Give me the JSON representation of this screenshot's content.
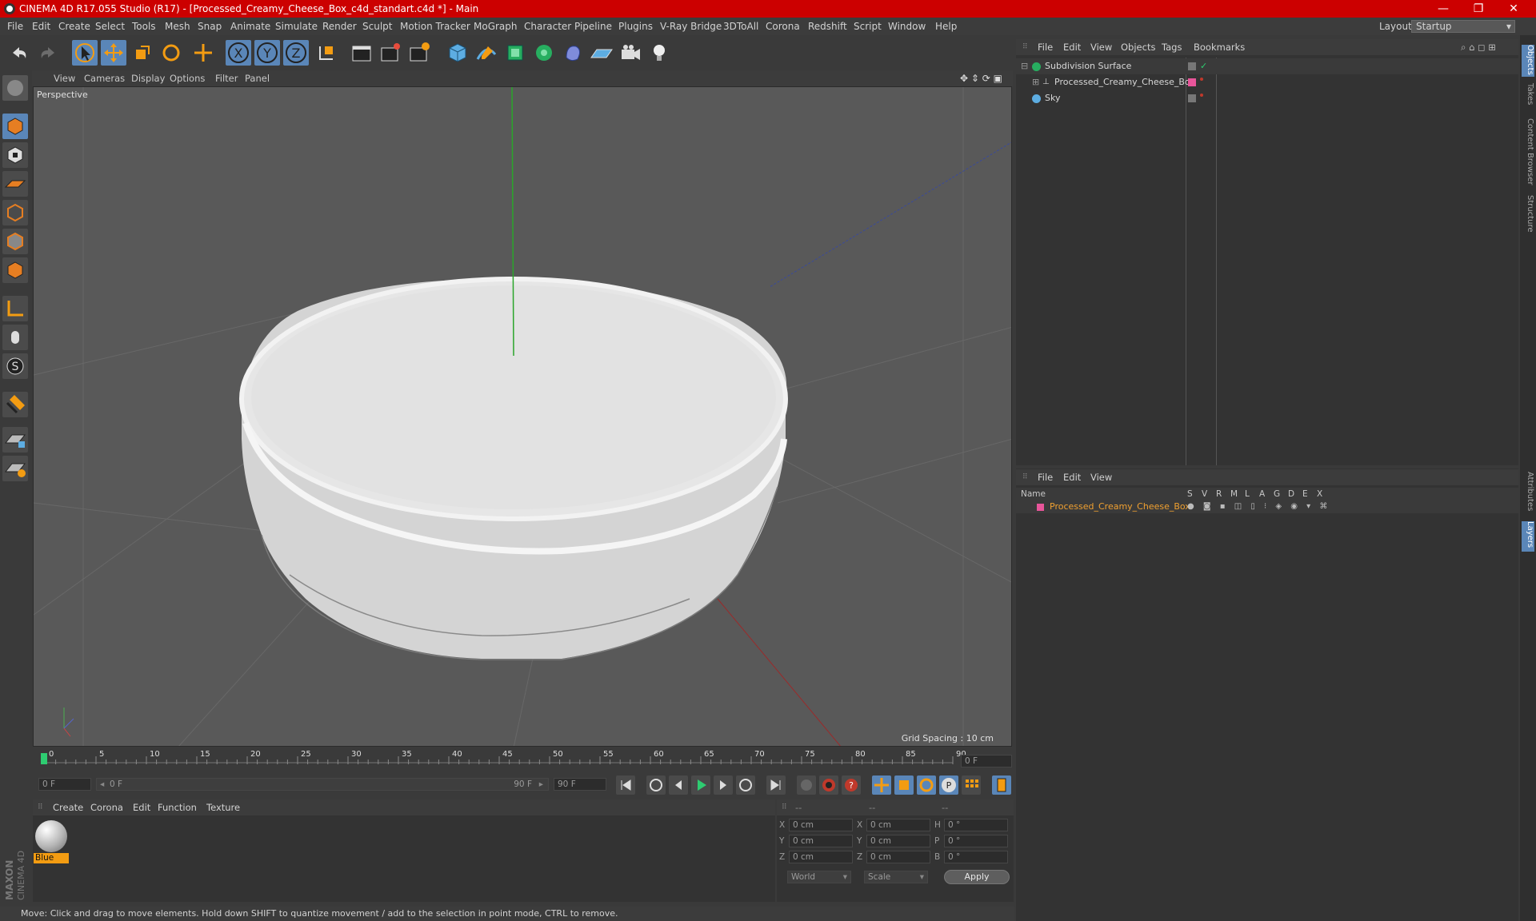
{
  "window": {
    "title": "CINEMA 4D R17.055 Studio (R17) - [Processed_Creamy_Cheese_Box_c4d_standart.c4d *] - Main",
    "minimize": "—",
    "restore": "❐",
    "close": "✕"
  },
  "menu": [
    "File",
    "Edit",
    "Create",
    "Select",
    "Tools",
    "Mesh",
    "Snap",
    "Animate",
    "Simulate",
    "Render",
    "Sculpt",
    "Motion Tracker",
    "MoGraph",
    "Character",
    "Pipeline",
    "Plugins",
    "V-Ray Bridge",
    "3DToAll",
    "Corona",
    "Redshift",
    "Script",
    "Window",
    "Help"
  ],
  "layout": {
    "label": "Layout:",
    "value": "Startup"
  },
  "viewport": {
    "menu": [
      "View",
      "Cameras",
      "Display",
      "Options",
      "Filter",
      "Panel"
    ],
    "camera": "Perspective",
    "grid_spacing": "Grid Spacing : 10 cm"
  },
  "objects_panel": {
    "menu": [
      "File",
      "Edit",
      "View",
      "Objects",
      "Tags",
      "Bookmarks"
    ],
    "items": [
      {
        "name": "Subdivision Surface"
      },
      {
        "name": "Processed_Creamy_Cheese_Box"
      },
      {
        "name": "Sky"
      }
    ]
  },
  "layers_panel": {
    "menu": [
      "File",
      "Edit",
      "View"
    ],
    "columns": [
      "Name",
      "S",
      "V",
      "R",
      "M",
      "L",
      "A",
      "G",
      "D",
      "E",
      "X"
    ],
    "row": "Processed_Creamy_Cheese_Box",
    "row_color": "#f0a030"
  },
  "right_tabs": [
    "Objects",
    "Takes",
    "Content Browser",
    "Structure",
    "Attributes",
    "Layers"
  ],
  "timeline": {
    "ticks": [
      "0",
      "5",
      "10",
      "15",
      "20",
      "25",
      "30",
      "35",
      "40",
      "45",
      "50",
      "55",
      "60",
      "65",
      "70",
      "75",
      "80",
      "85",
      "90"
    ],
    "current_frame": "0 F",
    "start": "0 F",
    "range_start": "0 F",
    "range_end": "90 F",
    "end": "90 F"
  },
  "materials": {
    "menu": [
      "Create",
      "Corona",
      "Edit",
      "Function",
      "Texture"
    ],
    "material_name": "Blue"
  },
  "coordinates": {
    "header": [
      "--",
      "--",
      "--"
    ],
    "rows": [
      {
        "a": "X",
        "av": "0 cm",
        "b": "X",
        "bv": "0 cm",
        "c": "H",
        "cv": "0 °"
      },
      {
        "a": "Y",
        "av": "0 cm",
        "b": "Y",
        "bv": "0 cm",
        "c": "P",
        "cv": "0 °"
      },
      {
        "a": "Z",
        "av": "0 cm",
        "b": "Z",
        "bv": "0 cm",
        "c": "B",
        "cv": "0 °"
      }
    ],
    "mode1": "World",
    "mode2": "Scale",
    "apply": "Apply"
  },
  "status": "Move: Click and drag to move elements. Hold down SHIFT to quantize movement / add to the selection in point mode, CTRL to remove.",
  "brand": "MAXON CINEMA 4D",
  "colors": {
    "title_bar": "#cc0000",
    "accent_blue": "#5a86b8",
    "obj_tag_pink": "#e8559a"
  }
}
